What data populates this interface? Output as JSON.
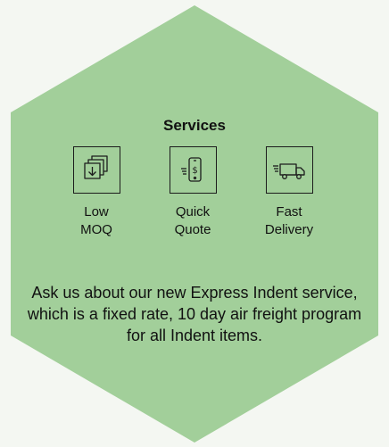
{
  "colors": {
    "background": "#f4f7f2",
    "hexagon": "#a2cf9a",
    "text": "#111111"
  },
  "title": "Services",
  "services": [
    {
      "line1": "Low",
      "line2": "MOQ",
      "icon": "stacked-documents-download-icon"
    },
    {
      "line1": "Quick",
      "line2": "Quote",
      "icon": "phone-dollar-icon"
    },
    {
      "line1": "Fast",
      "line2": "Delivery",
      "icon": "delivery-truck-icon"
    }
  ],
  "description": "Ask us about our new Express Indent service, which is a fixed rate, 10 day air freight program for all Indent items."
}
